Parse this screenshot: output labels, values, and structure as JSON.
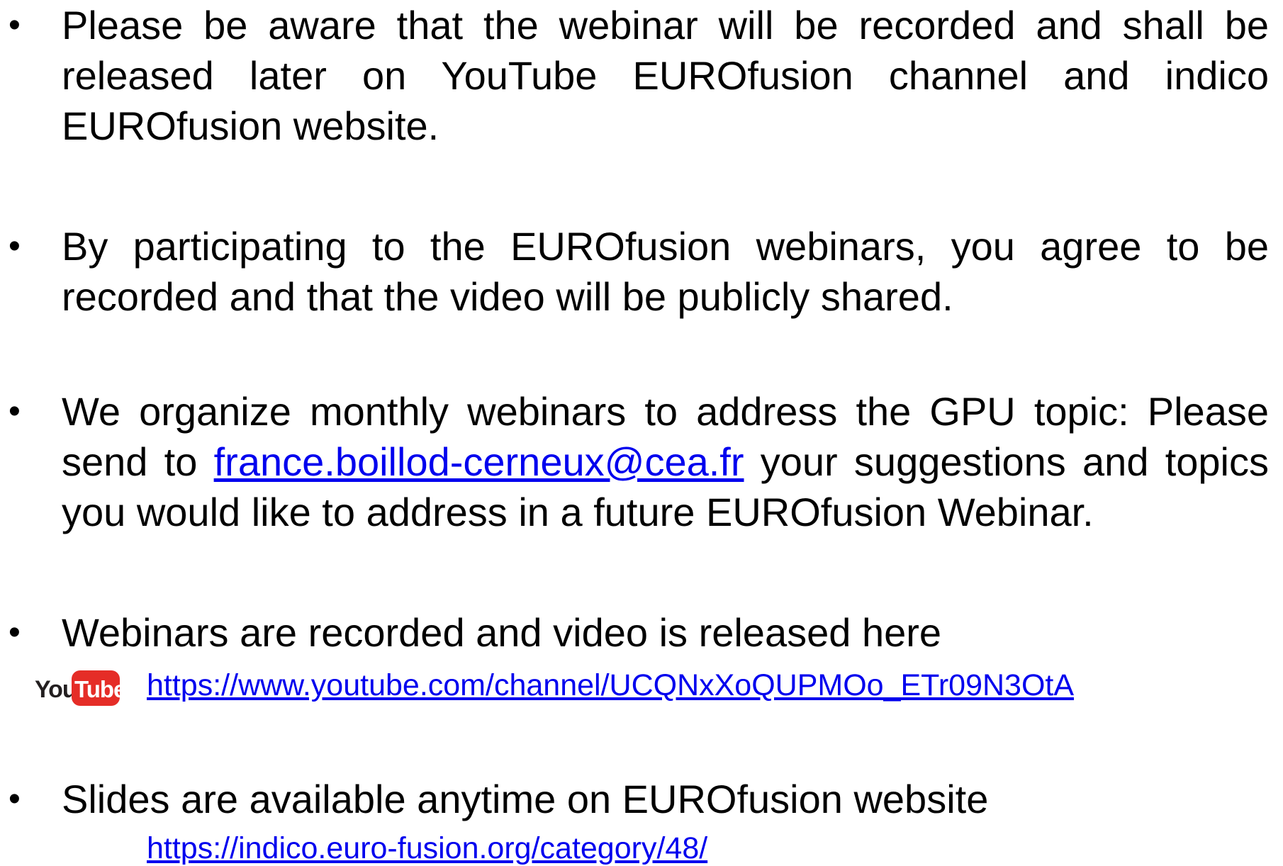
{
  "bullet_char": "•",
  "bullets": [
    {
      "text": "Please be aware that the webinar will be recorded and shall be released later on YouTube EUROfusion channel and indico EUROfusion website."
    },
    {
      "text": "By participating to the EUROfusion webinars, you agree to be recorded and that the video will be publicly shared."
    },
    {
      "pre": "We organize monthly webinars to address the GPU topic: Please send to ",
      "email": "france.boillod-cerneux@cea.fr",
      "post": " your suggestions and topics you would like to address in a future EUROfusion Webinar."
    },
    {
      "text": "Webinars are recorded and video is released here",
      "logo": {
        "text_you": "You",
        "text_tube": "Tube",
        "accent": "#e52d27"
      },
      "url": "https://www.youtube.com/channel/UCQNxXoQUPMOo_ETr09N3OtA"
    },
    {
      "text": "Slides are available anytime on EUROfusion website",
      "url": "https://indico.euro-fusion.org/category/48/"
    }
  ],
  "colors": {
    "text": "#000000",
    "link": "#0000ee",
    "background": "#ffffff"
  }
}
